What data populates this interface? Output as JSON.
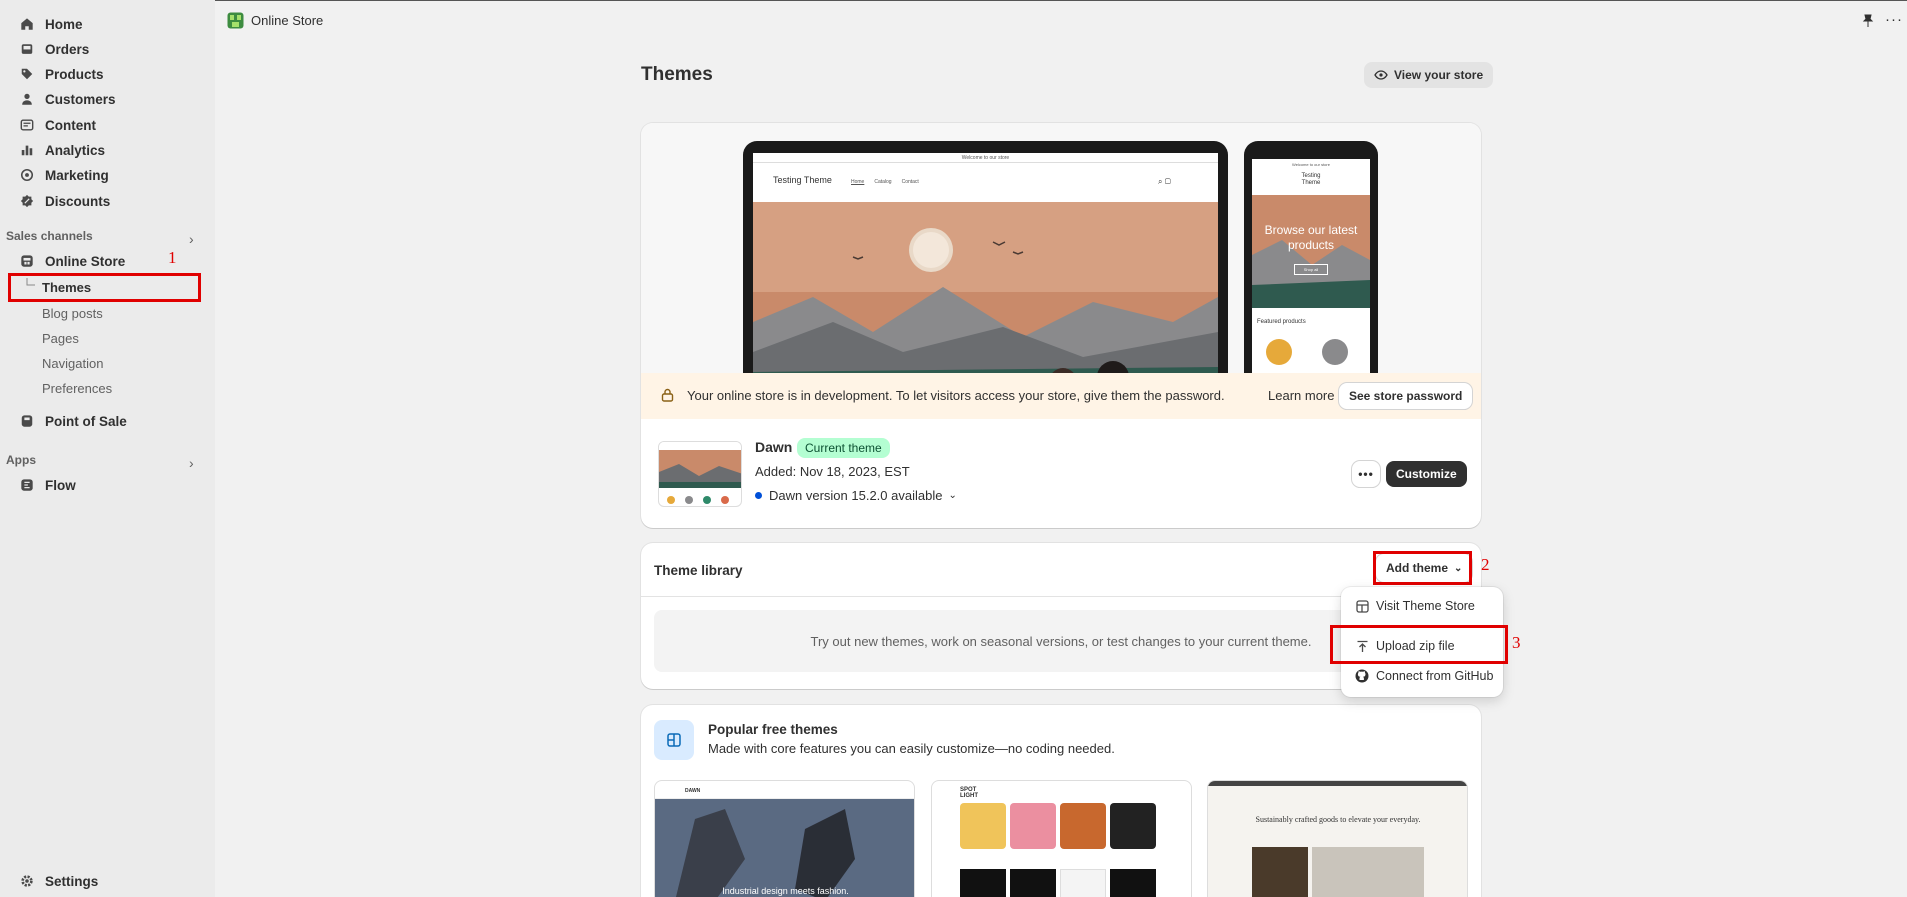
{
  "sidebar": {
    "items": [
      {
        "label": "Home",
        "icon": "home-icon"
      },
      {
        "label": "Orders",
        "icon": "inbox-icon"
      },
      {
        "label": "Products",
        "icon": "tag-icon"
      },
      {
        "label": "Customers",
        "icon": "person-icon"
      },
      {
        "label": "Content",
        "icon": "content-icon"
      },
      {
        "label": "Analytics",
        "icon": "bar-chart-icon"
      },
      {
        "label": "Marketing",
        "icon": "target-icon"
      },
      {
        "label": "Discounts",
        "icon": "discount-icon"
      }
    ],
    "sales_channels_label": "Sales channels",
    "online_store_label": "Online Store",
    "online_store_sub": [
      "Themes",
      "Blog posts",
      "Pages",
      "Navigation",
      "Preferences"
    ],
    "pos_label": "Point of Sale",
    "apps_label": "Apps",
    "flow_label": "Flow",
    "settings_label": "Settings"
  },
  "annotations": [
    "1",
    "2",
    "3"
  ],
  "topbar": {
    "title": "Online Store"
  },
  "page": {
    "title": "Themes",
    "view_store_label": "View your store"
  },
  "preview": {
    "laptop_welcome": "Welcome to our store",
    "laptop_brand": "Testing Theme",
    "laptop_nav": [
      "Home",
      "Catalog",
      "Contact"
    ],
    "phone_welcome": "Welcome to our store",
    "phone_brand": "Testing Theme",
    "phone_hero": "Browse our latest products",
    "phone_button": "Shop all",
    "phone_featured": "Featured products"
  },
  "banner": {
    "message": "Your online store is in development. To let visitors access your store, give them the password.",
    "learn_more": "Learn more",
    "password_button": "See store password"
  },
  "current_theme": {
    "name": "Dawn",
    "badge": "Current theme",
    "added": "Added: Nov 18, 2023, EST",
    "version": "Dawn version 15.2.0 available",
    "more_label": "•••",
    "customize_label": "Customize"
  },
  "library": {
    "title": "Theme library",
    "add_theme_label": "Add theme",
    "empty_text": "Try out new themes, work on seasonal versions, or test changes to your current theme.",
    "dropdown": [
      "Visit Theme Store",
      "Upload zip file",
      "Connect from GitHub"
    ]
  },
  "popular": {
    "title": "Popular free themes",
    "subtitle": "Made with core features you can easily customize—no coding needed.",
    "thumb1_brand": "DAWN",
    "thumb1_caption": "Industrial design meets fashion.",
    "thumb2_brand": "SPOT LIGHT",
    "thumb3_caption": "Sustainably crafted goods to elevate your everyday."
  },
  "colors": {
    "accent_dark": "#303030",
    "badge_bg": "#b4fed2",
    "banner_bg": "#fff4e6",
    "annotation_red": "#e00000"
  }
}
